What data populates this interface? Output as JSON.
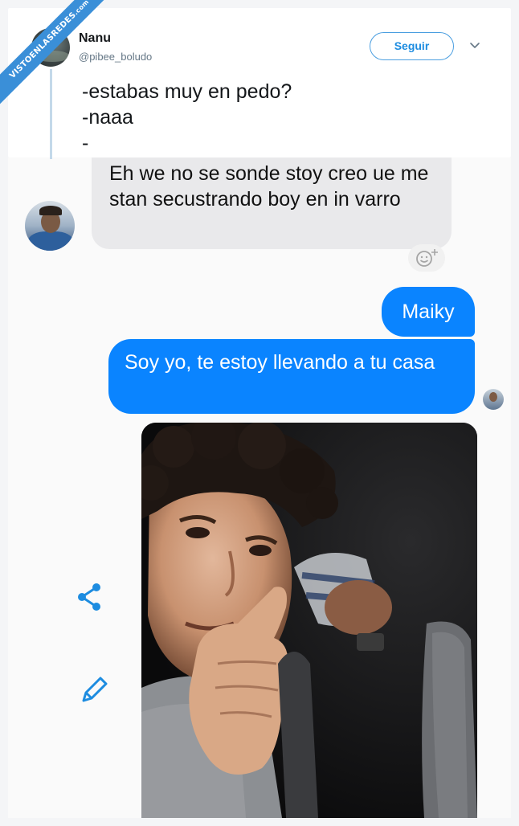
{
  "watermark": {
    "text": "VISTOENLASREDES",
    "suffix": ".com"
  },
  "tweet": {
    "display_name": "Nanu",
    "handle": "@pibee_boludo",
    "follow_label": "Seguir",
    "text_lines": [
      "-estabas muy en pedo?",
      "-naaa",
      "-"
    ]
  },
  "chat": {
    "incoming_message": "Eh we no se sonde stoy creo ue me stan secustrando boy en in varro",
    "outgoing_messages": [
      "Maiky",
      "Soy yo, te estoy llevando a tu casa"
    ],
    "reaction_icon": "emoji-plus-icon",
    "accent_color": "#0a84ff",
    "incoming_bubble_color": "#e9e9eb"
  },
  "colors": {
    "follow_blue": "#1d8ce0",
    "ribbon_blue": "#3a8fd8",
    "side_icons_blue": "#1d8ce0"
  }
}
